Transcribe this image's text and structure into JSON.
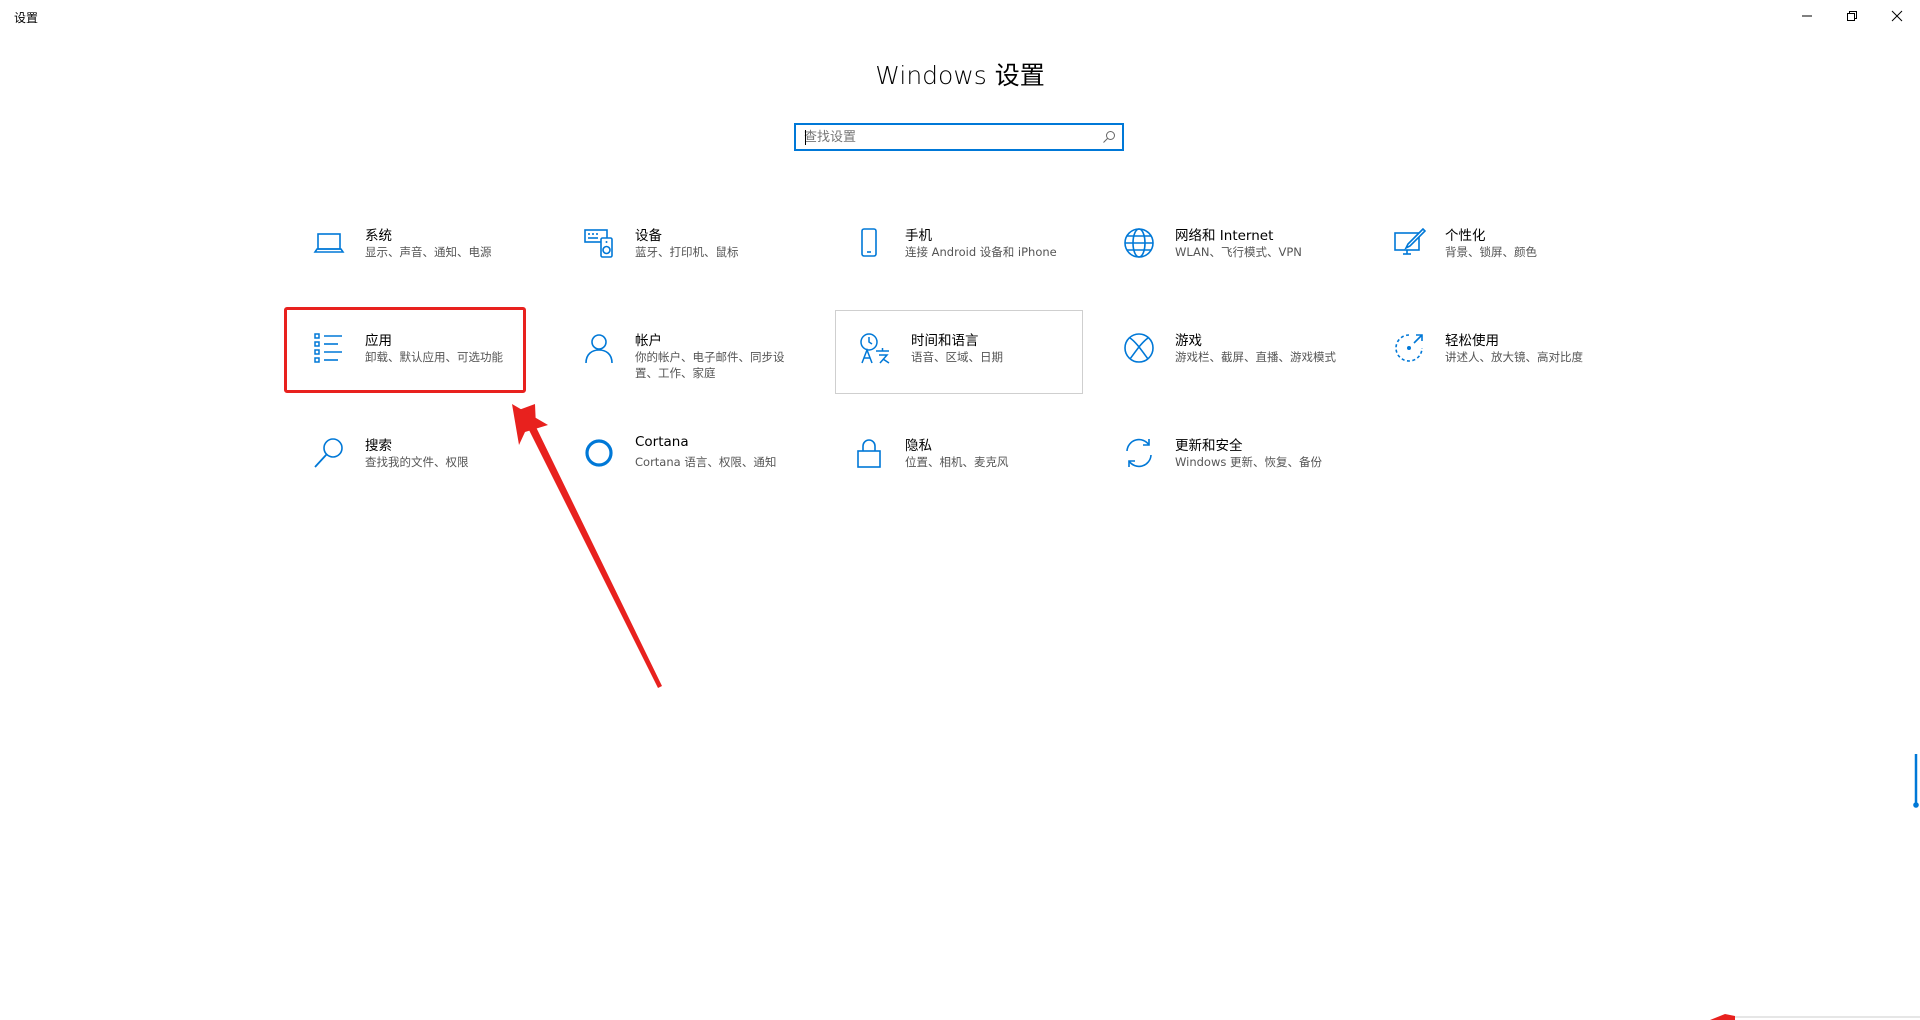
{
  "window": {
    "app_title": "设置",
    "controls": {
      "minimize_icon": "minimize-icon",
      "maximize_icon": "restore-icon",
      "close_icon": "close-icon"
    }
  },
  "page": {
    "title": "Windows 设置"
  },
  "search": {
    "placeholder": "查找设置",
    "value": "",
    "icon": "search-icon"
  },
  "tiles": [
    {
      "name": "系统",
      "desc": "显示、声音、通知、电源",
      "icon": "laptop-icon"
    },
    {
      "name": "设备",
      "desc": "蓝牙、打印机、鼠标",
      "icon": "keyboard-speaker-icon"
    },
    {
      "name": "手机",
      "desc": "连接 Android 设备和 iPhone",
      "icon": "phone-icon"
    },
    {
      "name": "网络和 Internet",
      "desc": "WLAN、飞行模式、VPN",
      "icon": "globe-icon"
    },
    {
      "name": "个性化",
      "desc": "背景、锁屏、颜色",
      "icon": "paint-icon"
    },
    {
      "name": "应用",
      "desc": "卸载、默认应用、可选功能",
      "icon": "apps-list-icon"
    },
    {
      "name": "帐户",
      "desc": "你的帐户、电子邮件、同步设置、工作、家庭",
      "icon": "person-icon"
    },
    {
      "name": "时间和语言",
      "desc": "语音、区域、日期",
      "icon": "time-language-icon"
    },
    {
      "name": "游戏",
      "desc": "游戏栏、截屏、直播、游戏模式",
      "icon": "xbox-icon"
    },
    {
      "name": "轻松使用",
      "desc": "讲述人、放大镜、高对比度",
      "icon": "ease-of-access-icon"
    },
    {
      "name": "搜索",
      "desc": "查找我的文件、权限",
      "icon": "search-icon"
    },
    {
      "name": "Cortana",
      "desc": "Cortana 语言、权限、通知",
      "icon": "cortana-icon"
    },
    {
      "name": "隐私",
      "desc": "位置、相机、麦克风",
      "icon": "lock-icon"
    },
    {
      "name": "更新和安全",
      "desc": "Windows 更新、恢复、备份",
      "icon": "update-icon"
    }
  ],
  "colors": {
    "accent": "#0078d7",
    "annotation": "#e8211e"
  }
}
